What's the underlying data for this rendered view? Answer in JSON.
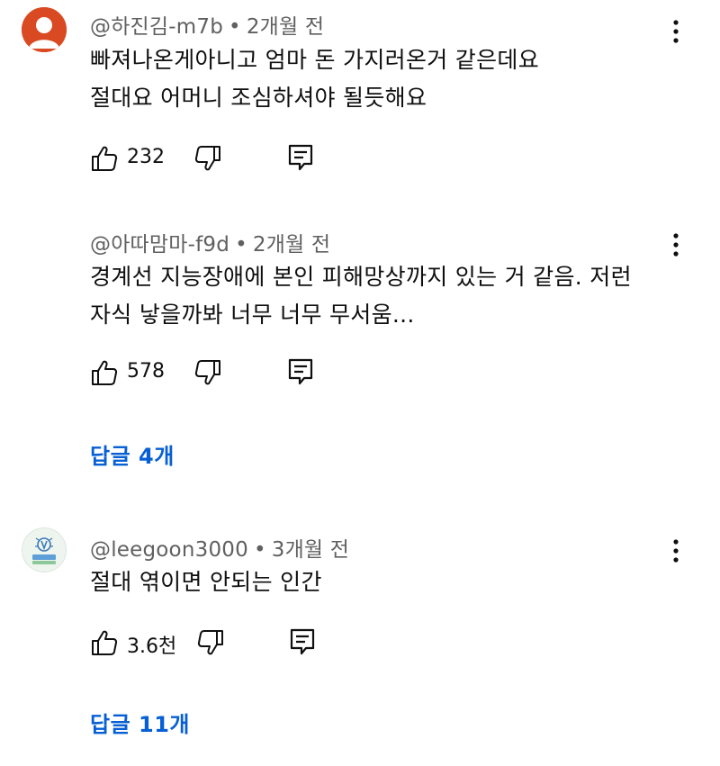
{
  "comments": [
    {
      "author": "@하진김-m7b",
      "separator": "•",
      "time": "2개월 전",
      "line1": "빠져나온게아니고 엄마 돈 가지러온거 같은데요",
      "line2": "절대요 어머니 조심하셔야 될듯해요",
      "likes": "232",
      "avatar_color": "#d94a22"
    },
    {
      "author": "@아따맘마-f9d",
      "separator": "•",
      "time": "2개월 전",
      "line1": "경계선 지능장애에 본인 피해망상까지 있는 거 같음. 저런",
      "line2": "자식 낳을까봐 너무 너무 무서움...",
      "likes": "578",
      "replies": "답글 4개"
    },
    {
      "author": "@leegoon3000",
      "separator": "•",
      "time": "3개월 전",
      "line1": "절대 엮이면 안되는 인간",
      "likes": "3.6천",
      "replies": "답글 11개"
    }
  ],
  "colors": {
    "link": "#065fd4",
    "meta": "#606060",
    "text": "#0f0f0f"
  },
  "icons": {
    "like": "thumbs-up-icon",
    "dislike": "thumbs-down-icon",
    "reply": "reply-icon",
    "more": "more-vert-icon",
    "avatar_default": "person-silhouette-icon"
  }
}
